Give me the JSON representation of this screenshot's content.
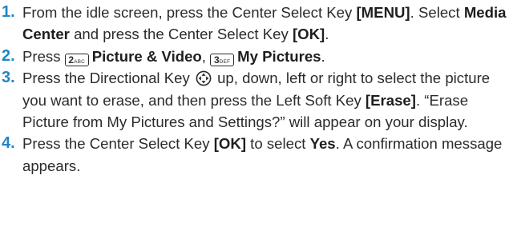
{
  "steps": [
    {
      "number": "1.",
      "segments": [
        "From the idle screen, press the Center Select Key ",
        "[MENU]",
        ". Select ",
        "Media Center",
        " and press the Center Select Key ",
        "[OK]",
        "."
      ]
    },
    {
      "number": "2.",
      "prefix": "Press",
      "key1": {
        "digit": "2",
        "letters": "ABC"
      },
      "item1": "Picture & Video",
      "separator": ",",
      "key2": {
        "digit": "3",
        "letters": "DEF"
      },
      "item2": "My Pictures",
      "end": "."
    },
    {
      "number": "3.",
      "before_icon": "Press the Directional Key ",
      "icon_name": "directional-key-icon",
      "after_icon": " up, down, left or right to select the picture you want to erase, and then press the Left Soft Key ",
      "softkey": "[Erase]",
      "rest": ". “Erase Picture from My Pictures and Settings?” will appear on your display."
    },
    {
      "number": "4.",
      "segments": [
        "Press the Center Select Key ",
        "[OK]",
        " to select ",
        "Yes",
        ". A confirmation message appears."
      ]
    }
  ],
  "colors": {
    "step_number": "#1f86c8",
    "text": "#2b2b2b"
  }
}
